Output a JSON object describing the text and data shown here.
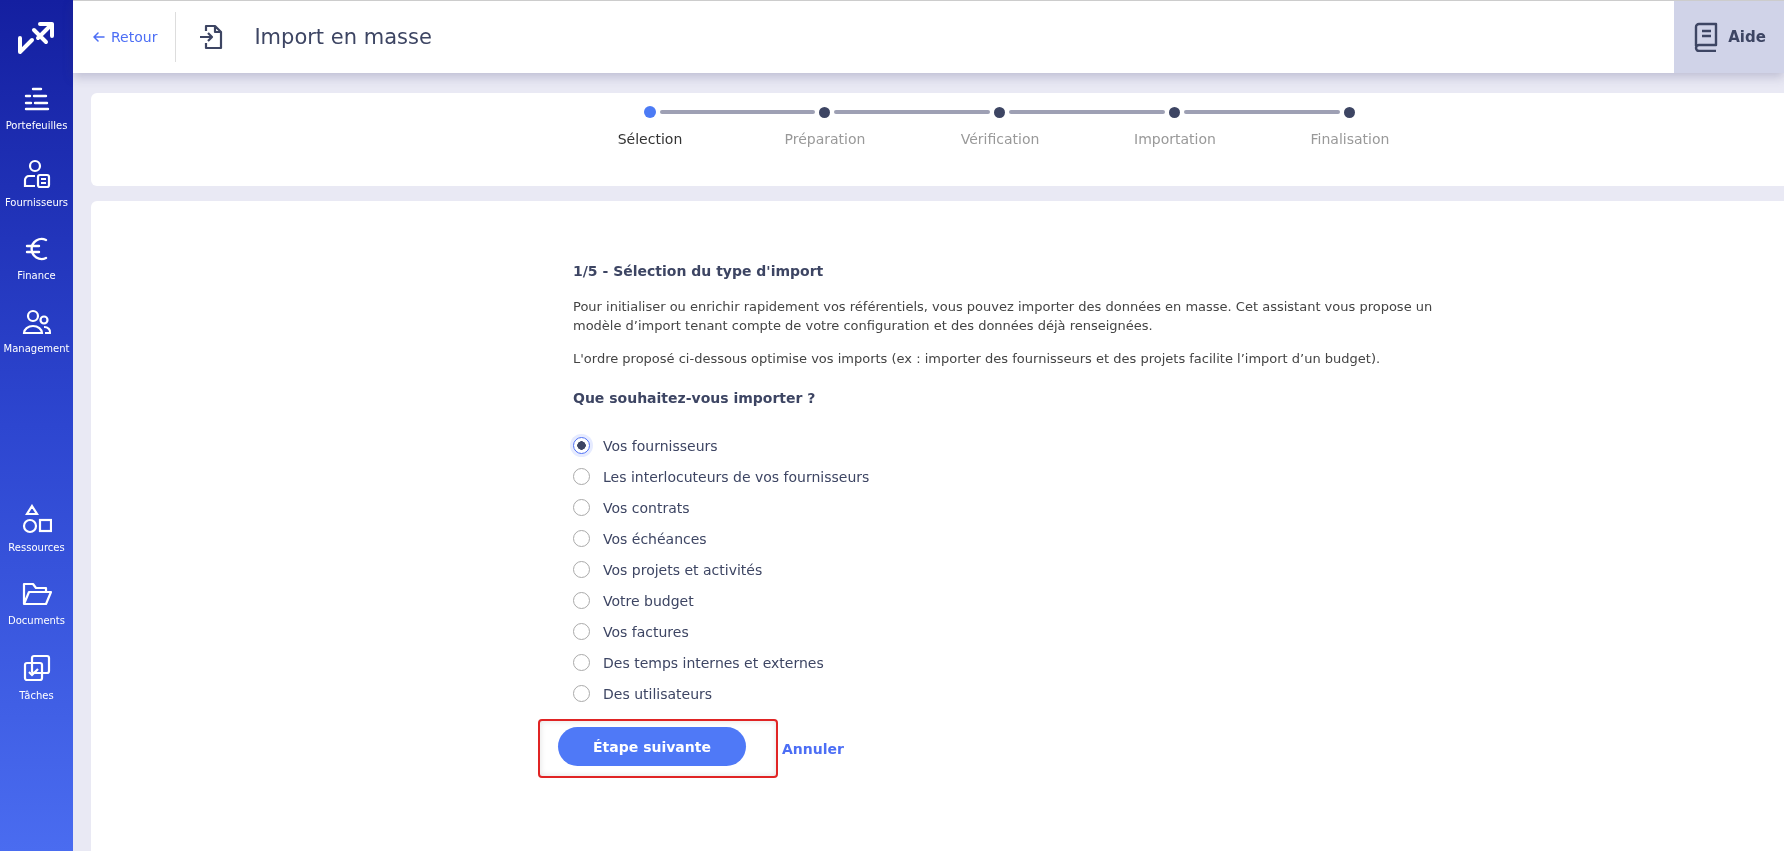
{
  "sidebar": {
    "top_items": [
      {
        "label": "Portefeuilles",
        "kind": "portfolio"
      },
      {
        "label": "Fournisseurs",
        "kind": "supplier"
      },
      {
        "label": "Finance",
        "kind": "finance"
      },
      {
        "label": "Management",
        "kind": "team"
      }
    ],
    "bottom_items": [
      {
        "label": "Ressources",
        "kind": "shapes"
      },
      {
        "label": "Documents",
        "kind": "folder"
      },
      {
        "label": "Tâches",
        "kind": "tasks"
      }
    ]
  },
  "header": {
    "back_link": "Retour",
    "title": "Import en masse",
    "help_button": "Aide"
  },
  "steps": [
    {
      "label": "Sélection",
      "selected": true
    },
    {
      "label": "Préparation",
      "selected": false
    },
    {
      "label": "Vérification",
      "selected": false
    },
    {
      "label": "Importation",
      "selected": false
    },
    {
      "label": "Finalisation",
      "selected": false
    }
  ],
  "form": {
    "heading": "1/5 - Sélection du type d'import",
    "paragraphs": [
      "Pour initialiser ou enrichir rapidement vos référentiels, vous pouvez importer des données en masse. Cet assistant vous propose un modèle d’import tenant compte de votre configuration et des données déjà renseignées.",
      "L'ordre proposé ci-dessous optimise vos imports (ex : importer des fournisseurs et des projets facilite l’import d’un budget)."
    ],
    "question": "Que souhaitez-vous importer ?",
    "options": [
      {
        "label": "Vos fournisseurs",
        "selected": true
      },
      {
        "label": "Les interlocuteurs de vos fournisseurs",
        "selected": false
      },
      {
        "label": "Vos contrats",
        "selected": false
      },
      {
        "label": "Vos échéances",
        "selected": false
      },
      {
        "label": "Vos projets et activités",
        "selected": false
      },
      {
        "label": "Votre budget",
        "selected": false
      },
      {
        "label": "Vos factures",
        "selected": false
      },
      {
        "label": "Des temps internes et externes",
        "selected": false
      },
      {
        "label": "Des utilisateurs",
        "selected": false
      }
    ],
    "next_button": {
      "label": "Étape suivante",
      "highlighted": true
    },
    "cancel_link": "Annuler"
  }
}
